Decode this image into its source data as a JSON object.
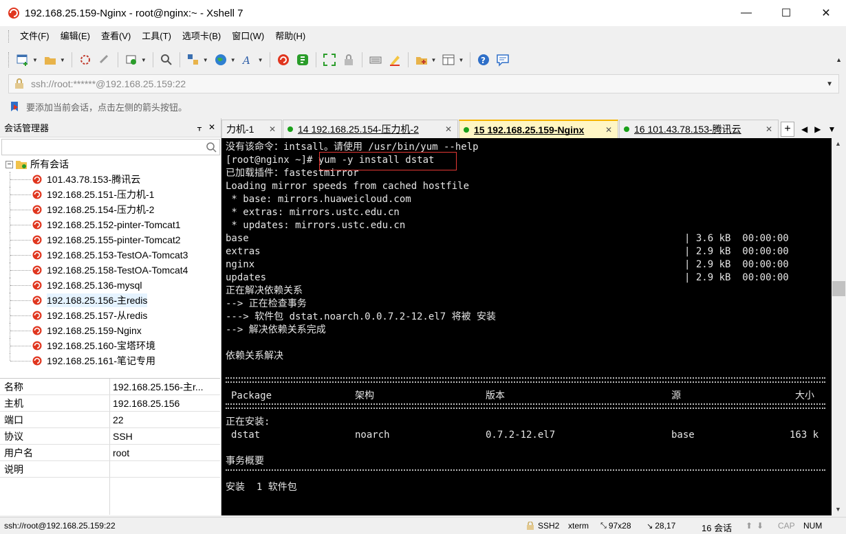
{
  "window": {
    "title": "192.168.25.159-Nginx - root@nginx:~ - Xshell 7",
    "minimize": "—",
    "maximize": "☐",
    "close": "✕"
  },
  "menu": [
    "文件(F)",
    "编辑(E)",
    "查看(V)",
    "工具(T)",
    "选项卡(B)",
    "窗口(W)",
    "帮助(H)"
  ],
  "address": {
    "value": "ssh://root:******@192.168.25.159:22"
  },
  "hint": "要添加当前会话，点击左侧的箭头按钮。",
  "session_manager": {
    "title": "会话管理器",
    "pin": "ᚁ",
    "close": "✕",
    "root_label": "所有会话",
    "sessions": [
      "101.43.78.153-腾讯云",
      "192.168.25.151-压力机-1",
      "192.168.25.154-压力机-2",
      "192.168.25.152-pinter-Tomcat1",
      "192.168.25.155-pinter-Tomcat2",
      "192.168.25.153-TestOA-Tomcat3",
      "192.168.25.158-TestOA-Tomcat4",
      "192.168.25.136-mysql",
      "192.168.25.156-主redis",
      "192.168.25.157-从redis",
      "192.168.25.159-Nginx",
      "192.168.25.160-宝塔环境",
      "192.168.25.161-笔记专用"
    ],
    "selected_index": 8,
    "properties": [
      {
        "key": "名称",
        "value": "192.168.25.156-主r..."
      },
      {
        "key": "主机",
        "value": "192.168.25.156"
      },
      {
        "key": "端口",
        "value": "22"
      },
      {
        "key": "协议",
        "value": "SSH"
      },
      {
        "key": "用户名",
        "value": "root"
      },
      {
        "key": "说明",
        "value": ""
      }
    ]
  },
  "tabs": [
    {
      "label": "力机-1",
      "active": false,
      "dot": false
    },
    {
      "label": "14 192.168.25.154-压力机-2",
      "active": false,
      "dot": true
    },
    {
      "label": "15 192.168.25.159-Nginx",
      "active": true,
      "dot": true
    },
    {
      "label": "16 101.43.78.153-腾讯云",
      "active": false,
      "dot": true
    }
  ],
  "tab_close": "✕",
  "tab_add": "+",
  "terminal": {
    "lines": [
      "没有该命令：intsall。请使用 /usr/bin/yum --help",
      "[root@nginx ~]# yum -y install dstat",
      "已加载插件：fastestmirror",
      "Loading mirror speeds from cached hostfile",
      " * base: mirrors.huaweicloud.com",
      " * extras: mirrors.ustc.edu.cn",
      " * updates: mirrors.ustc.edu.cn",
      "base",
      "extras",
      "nginx",
      "updates",
      "正在解决依赖关系",
      "--> 正在检查事务",
      "---> 软件包 dstat.noarch.0.0.7.2-12.el7 将被 安装",
      "--> 解决依赖关系完成",
      "",
      "依赖关系解决"
    ],
    "repo_stats": [
      "| 3.6 kB  00:00:00",
      "| 2.9 kB  00:00:00",
      "| 2.9 kB  00:00:00",
      "| 2.9 kB  00:00:00"
    ],
    "table_headers": [
      "Package",
      "架构",
      "版本",
      "源",
      "大小"
    ],
    "installing_label": "正在安装:",
    "package_row": [
      "dstat",
      "noarch",
      "0.7.2-12.el7",
      "base",
      "163 k"
    ],
    "summary_label": "事务概要",
    "install_count": "安装  1 软件包"
  },
  "status": {
    "connection": "ssh://root@192.168.25.159:22",
    "protocol": "SSH2",
    "term": "xterm",
    "size": "97x28",
    "cursor": "28,17",
    "sessions": "16 会话",
    "cap": "CAP",
    "num": "NUM"
  },
  "colors": {
    "active_tab": "#fff6c4",
    "tab_accent": "#f5b400",
    "highlight_box": "#e53935",
    "online_dot": "#1aa01a"
  }
}
